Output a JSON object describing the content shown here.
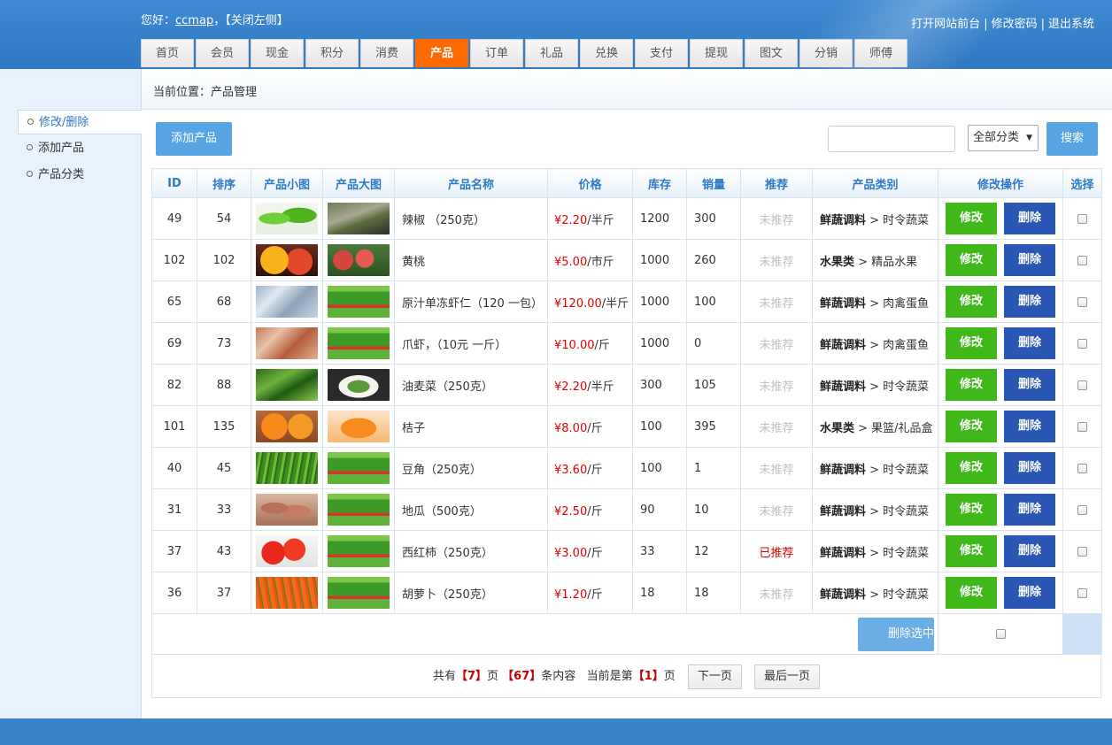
{
  "header": {
    "greeting_prefix": "您好：",
    "username": "ccmap",
    "greeting_suffix": "，",
    "close_left": "【关闭左侧】",
    "links": [
      "打开网站前台",
      "修改密码",
      "退出系统"
    ],
    "nav_tabs": [
      "首页",
      "会员",
      "现金",
      "积分",
      "消费",
      "产品",
      "订单",
      "礼品",
      "兑换",
      "支付",
      "提现",
      "图文",
      "分销",
      "师傅"
    ],
    "active_tab": "产品"
  },
  "sidebar": {
    "items": [
      "修改/删除",
      "添加产品",
      "产品分类"
    ],
    "active": 0
  },
  "breadcrumb": "当前位置：产品管理",
  "toolbar": {
    "add_label": "添加产品",
    "search_value": "",
    "category_selected": "全部分类",
    "search_label": "搜索"
  },
  "table": {
    "headers": [
      "ID",
      "排序",
      "产品小图",
      "产品大图",
      "产品名称",
      "价格",
      "库存",
      "销量",
      "推荐",
      "产品类别",
      "修改操作",
      "选择"
    ],
    "edit_label": "修改",
    "delete_label": "删除",
    "rows": [
      {
        "id": "49",
        "sort": "54",
        "name": "辣椒 （250克）",
        "price": "¥2.20",
        "unit": "/半斤",
        "stock": "1200",
        "sales": "300",
        "recommend": "未推荐",
        "cat_main": "鲜蔬调料",
        "cat_sub": " > 时令蔬菜",
        "small": "pepper",
        "big": "pepper2"
      },
      {
        "id": "102",
        "sort": "102",
        "name": "黄桃",
        "price": "¥5.00",
        "unit": "/市斤",
        "stock": "1000",
        "sales": "260",
        "recommend": "未推荐",
        "cat_main": "水果类",
        "cat_sub": " > 精品水果",
        "small": "peach",
        "big": "peach2"
      },
      {
        "id": "65",
        "sort": "68",
        "name": "原汁单冻虾仁（120 一包）",
        "price": "¥120.00",
        "unit": "/半斤",
        "stock": "1000",
        "sales": "100",
        "recommend": "未推荐",
        "cat_main": "鲜蔬调料",
        "cat_sub": " > 肉禽蛋鱼",
        "small": "shrimp",
        "big": "banner"
      },
      {
        "id": "69",
        "sort": "73",
        "name": "爪虾，（10元 一斤）",
        "price": "¥10.00",
        "unit": "/斤",
        "stock": "1000",
        "sales": "0",
        "recommend": "未推荐",
        "cat_main": "鲜蔬调料",
        "cat_sub": " > 肉禽蛋鱼",
        "small": "prawn",
        "big": "banner"
      },
      {
        "id": "82",
        "sort": "88",
        "name": "油麦菜（250克）",
        "price": "¥2.20",
        "unit": "/半斤",
        "stock": "300",
        "sales": "105",
        "recommend": "未推荐",
        "cat_main": "鲜蔬调料",
        "cat_sub": " > 时令蔬菜",
        "small": "lettuce",
        "big": "dish"
      },
      {
        "id": "101",
        "sort": "135",
        "name": "桔子",
        "price": "¥8.00",
        "unit": "/斤",
        "stock": "100",
        "sales": "395",
        "recommend": "未推荐",
        "cat_main": "水果类",
        "cat_sub": " > 果篮/礼品盒",
        "small": "orange",
        "big": "orange2"
      },
      {
        "id": "40",
        "sort": "45",
        "name": "豆角（250克）",
        "price": "¥3.60",
        "unit": "/斤",
        "stock": "100",
        "sales": "1",
        "recommend": "未推荐",
        "cat_main": "鲜蔬调料",
        "cat_sub": " > 时令蔬菜",
        "small": "beans",
        "big": "banner"
      },
      {
        "id": "31",
        "sort": "33",
        "name": "地瓜（500克）",
        "price": "¥2.50",
        "unit": "/斤",
        "stock": "90",
        "sales": "10",
        "recommend": "未推荐",
        "cat_main": "鲜蔬调料",
        "cat_sub": " > 时令蔬菜",
        "small": "potato",
        "big": "banner"
      },
      {
        "id": "37",
        "sort": "43",
        "name": "西红柿（250克）",
        "price": "¥3.00",
        "unit": "/斤",
        "stock": "33",
        "sales": "12",
        "recommend": "已推荐",
        "cat_main": "鲜蔬调料",
        "cat_sub": " > 时令蔬菜",
        "small": "tomato",
        "big": "banner"
      },
      {
        "id": "36",
        "sort": "37",
        "name": "胡萝卜（250克）",
        "price": "¥1.20",
        "unit": "/斤",
        "stock": "18",
        "sales": "18",
        "recommend": "未推荐",
        "cat_main": "鲜蔬调料",
        "cat_sub": " > 时令蔬菜",
        "small": "carrot",
        "big": "banner"
      }
    ],
    "delete_selected_label": "删除选中"
  },
  "pager": {
    "total_prefix": "共有",
    "total_pages": "【7】",
    "pages_word": "页",
    "total_items": "【67】",
    "items_word": "条内容",
    "current_prefix": "当前是第",
    "current_page": "【1】",
    "current_suffix": "页",
    "next_label": "下一页",
    "last_label": "最后一页"
  },
  "colors": {
    "header_blue": "#2f79c4",
    "active_tab": "#ff6a00",
    "edit_green": "#41b81a",
    "delete_blue": "#2957b3",
    "price_red": "#e60000"
  }
}
